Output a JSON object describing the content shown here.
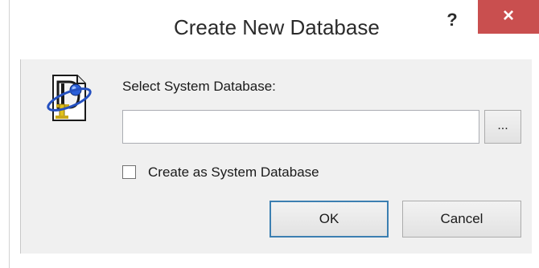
{
  "window": {
    "title": "Create New Database",
    "help_label": "?",
    "close_label": "×",
    "close_color": "#c94f4f"
  },
  "icon": {
    "name": "database-app-icon"
  },
  "form": {
    "select_label": "Select System Database:",
    "path_value": "",
    "path_placeholder": "",
    "browse_label": "...",
    "checkbox_label": "Create as System Database",
    "checkbox_checked": false
  },
  "buttons": {
    "ok_label": "OK",
    "cancel_label": "Cancel"
  }
}
